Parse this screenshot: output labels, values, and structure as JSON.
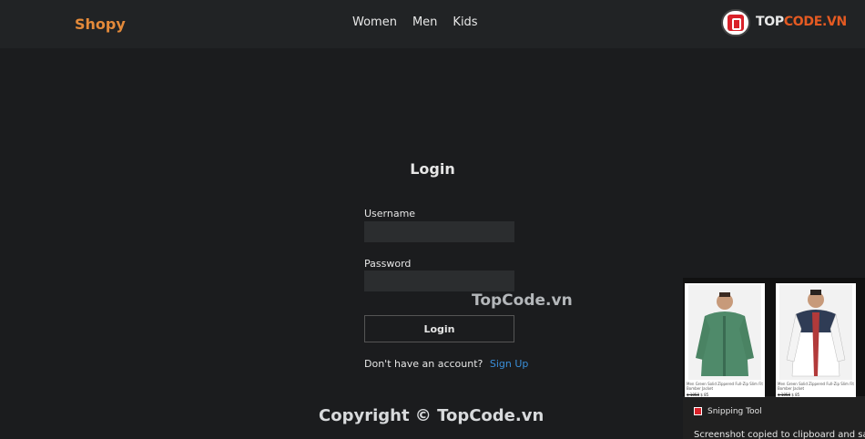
{
  "navbar": {
    "brand": "Shopy",
    "links": [
      "Women",
      "Men",
      "Kids"
    ]
  },
  "logo": {
    "prefix": "TOP",
    "suffix": "CODE.VN",
    "icon": "topcode-logo-icon"
  },
  "login": {
    "title": "Login",
    "username_label": "Username",
    "username_value": "",
    "password_label": "Password",
    "password_value": "",
    "submit_label": "Login",
    "signup_prompt": "Don't have an account?",
    "signup_link": "Sign Up"
  },
  "watermark": {
    "center": "TopCode.vn",
    "copyright": "Copyright © TopCode.vn"
  },
  "snipping_tool": {
    "app_name": "Snipping Tool",
    "message": "Screenshot copied to clipboard and saved",
    "products": [
      {
        "name": "Men Green Solid Zippered Full-Zip Slim Fit Bomber Jacket",
        "price": "$ 85",
        "old_price": "$ 1858"
      },
      {
        "name": "Men Green Solid Zippered Full-Zip Slim Fit Bomber Jacket",
        "price": "$ 85",
        "old_price": "$ 1858"
      }
    ]
  },
  "colors": {
    "background": "#1b1c1e",
    "navbar": "#212325",
    "brand": "#e48a3a",
    "link": "#3a8fd9",
    "input": "#2b2d2f"
  }
}
